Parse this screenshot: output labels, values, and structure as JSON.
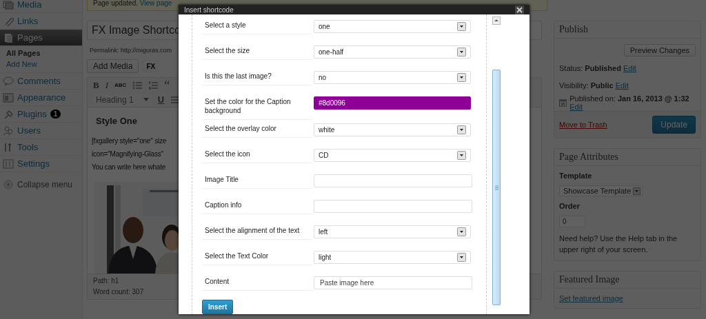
{
  "admin_menu": {
    "items": [
      {
        "label": "Media",
        "selected": false
      },
      {
        "label": "Links",
        "selected": false
      },
      {
        "label": "Pages",
        "selected": true,
        "children": [
          {
            "label": "All Pages",
            "selected": true
          },
          {
            "label": "Add New",
            "selected": false
          }
        ]
      },
      {
        "label": "Comments",
        "selected": false
      },
      {
        "label": "Appearance",
        "selected": false
      },
      {
        "label": "Plugins",
        "selected": false,
        "badge": "1"
      },
      {
        "label": "Users",
        "selected": false
      },
      {
        "label": "Tools",
        "selected": false
      },
      {
        "label": "Settings",
        "selected": false
      },
      {
        "label": "Collapse menu",
        "selected": false,
        "kind": "collapse"
      }
    ]
  },
  "notice": {
    "text": "Page updated.",
    "link": "View page"
  },
  "editor": {
    "title_value": "FX Image Shortco",
    "permalink": "Permalink: http://miguras.com",
    "buttons": [
      "Add Media",
      "FX"
    ],
    "toolbar": [
      {
        "kind": "bold",
        "label": "B"
      },
      {
        "kind": "italic",
        "label": "I"
      },
      {
        "kind": "strike",
        "label": "ABC"
      },
      {
        "kind": "bullets"
      },
      {
        "kind": "numbers"
      },
      {
        "kind": "quote",
        "label": "“"
      }
    ],
    "format_select": "Heading 1",
    "toolbar2": [
      {
        "kind": "underline",
        "label": "U"
      },
      {
        "kind": "justify"
      }
    ],
    "heading": "Style One",
    "lines": [
      "[fxgallery style=\"one\" size",
      "icon=\"Magnifying-Glass\"",
      "You can write here whate"
    ],
    "content_picture": {
      "kind": "picture"
    },
    "path": "Path: h1",
    "word_count": "Word count: 307"
  },
  "publish": {
    "title": "Publish",
    "preview_button": "Preview Changes",
    "lines": [
      {
        "kind": "status",
        "text": "Status: **Published** ",
        "link": "Edit"
      },
      {
        "kind": "visibility",
        "text": "Visibility: **Public** ",
        "link": "Edit"
      },
      {
        "kind": "date",
        "text": "Published on: **Jan 16, 2013 @ 1:32** ",
        "link": "Edit"
      }
    ],
    "trash_link": "Move to Trash",
    "update_button": "Update"
  },
  "page_attributes": {
    "title": "Page Attributes",
    "template_label": "Template",
    "template_value": "Showcase Template",
    "order_label": "Order",
    "order_value": "0",
    "help": "Need help? Use the Help tab in the upper right of your screen."
  },
  "featured_image": {
    "title": "Featured Image",
    "link": "Set featured image"
  },
  "dialog": {
    "title": "Insert shortcode",
    "fields": [
      {
        "label": "Select a style",
        "kind": "select",
        "value": "one"
      },
      {
        "label": "Select the size",
        "kind": "select",
        "value": "one-half"
      },
      {
        "label": "Is this the last image?",
        "kind": "select",
        "value": "no"
      },
      {
        "label": "Set the color for the Caption background",
        "kind": "color",
        "value": "#8d0096",
        "color": "#8d0096"
      },
      {
        "label": "Select the overlay color",
        "kind": "select",
        "value": "white"
      },
      {
        "label": "Select the icon",
        "kind": "select",
        "value": "CD"
      },
      {
        "label": "Image Title",
        "kind": "text"
      },
      {
        "label": "Caption info",
        "kind": "text"
      },
      {
        "label": "Select the alignment of the text",
        "kind": "select",
        "value": "left"
      },
      {
        "label": "Select the Text Color",
        "kind": "select",
        "value": "light"
      },
      {
        "label": "Content",
        "kind": "text",
        "value": "Paste image here"
      }
    ],
    "insert_button": "Insert"
  }
}
